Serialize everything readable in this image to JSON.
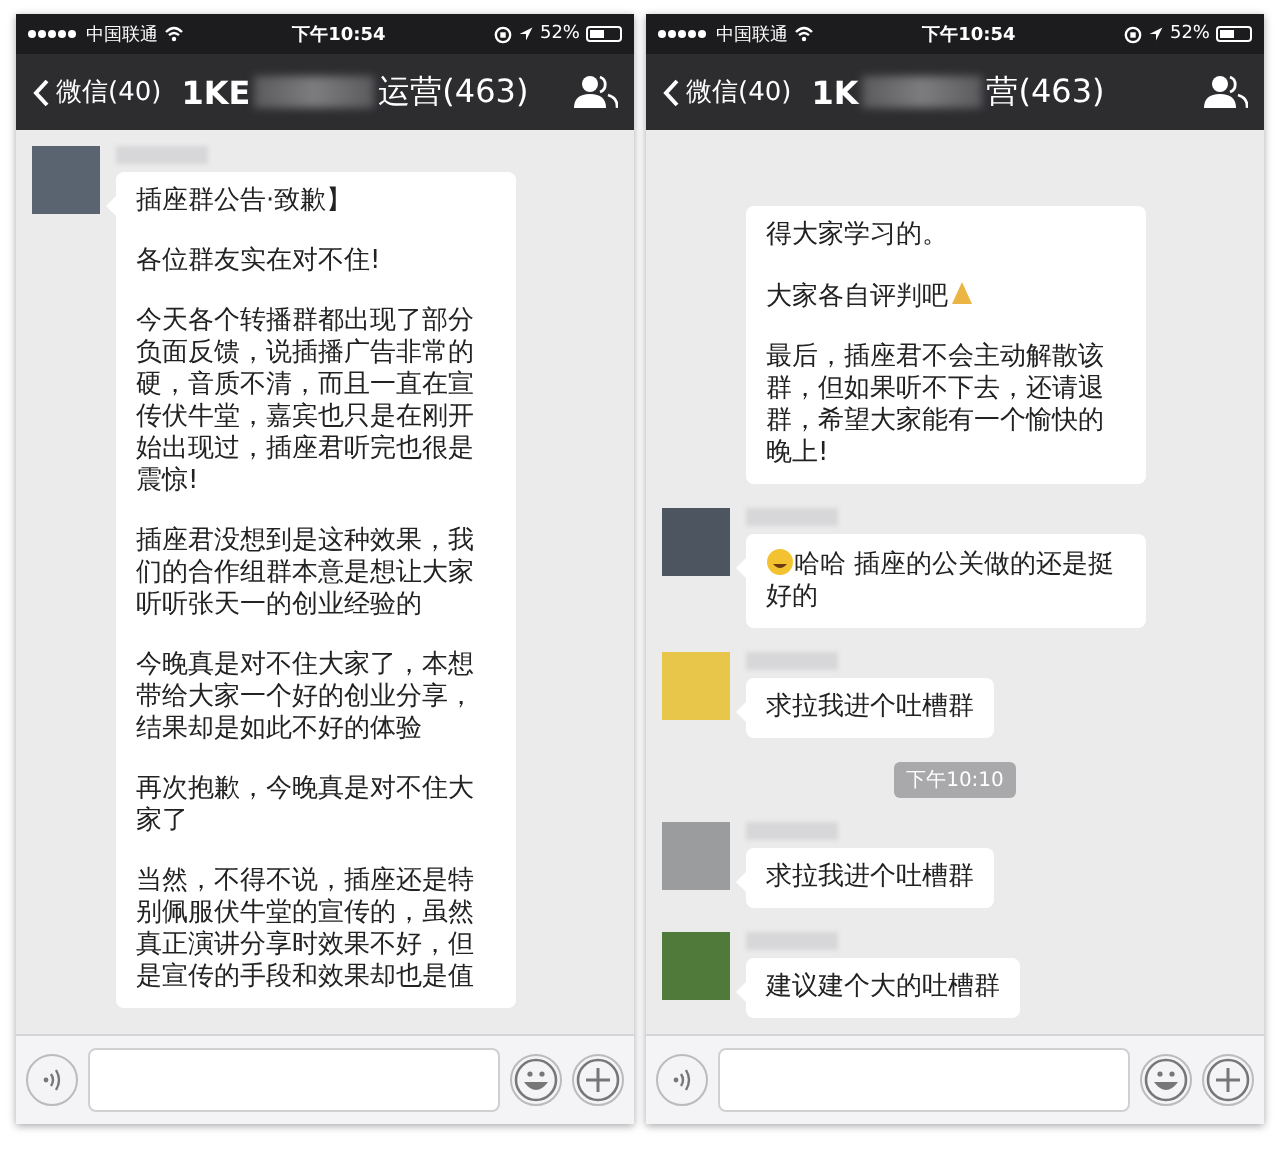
{
  "screens": [
    {
      "status_bar": {
        "carrier": "中国联通",
        "time": "下午10:54",
        "battery": "52%"
      },
      "nav": {
        "back": "微信(40)",
        "title_start": "1KE",
        "title_end": "运营(463)"
      },
      "items": [
        {
          "kind": "message",
          "color": "#5a6470",
          "paragraphs": [
            {
              "text": "插座群公告·致歉】"
            },
            {
              "text": "各位群友实在对不住!"
            },
            {
              "text": "今天各个转播群都出现了部分负面反馈，说插播广告非常的硬，音质不清，而且一直在宣传伏牛堂，嘉宾也只是在刚开始出现过，插座君听完也很是震惊!"
            },
            {
              "text": "插座君没想到是这种效果，我们的合作组群本意是想让大家听听张天一的创业经验的"
            },
            {
              "text": "今晚真是对不住大家了，本想带给大家一个好的创业分享，结果却是如此不好的体验"
            },
            {
              "text": "再次抱歉，今晚真是对不住大家了"
            },
            {
              "text": "当然，不得不说，插座还是特别佩服伏牛堂的宣传的，虽然真正演讲分享时效果不好，但是宣传的手段和效果却也是值"
            }
          ]
        }
      ]
    },
    {
      "status_bar": {
        "carrier": "中国联通",
        "time": "下午10:54",
        "battery": "52%"
      },
      "nav": {
        "back": "微信(40)",
        "title_start": "1K",
        "title_end": "营(463)"
      },
      "items": [
        {
          "kind": "continued",
          "paragraphs": [
            {
              "text": "得大家学习的。"
            },
            {
              "text": "大家各自评判吧",
              "emoji_after": true
            },
            {
              "text": "最后，插座君不会主动解散该群，但如果听不下去，还请退群，希望大家能有一个愉快的晚上!"
            }
          ]
        },
        {
          "kind": "message",
          "color": "#4d5560",
          "paragraphs": [
            {
              "text": "哈哈  插座的公关做的还是挺好的",
              "emoji_before": true
            }
          ]
        },
        {
          "kind": "message",
          "color": "#e8c64a",
          "paragraphs": [
            {
              "text": "求拉我进个吐槽群"
            }
          ]
        },
        {
          "kind": "time",
          "text": "下午10:10"
        },
        {
          "kind": "message",
          "color": "#9a9c9e",
          "paragraphs": [
            {
              "text": "求拉我进个吐槽群"
            }
          ]
        },
        {
          "kind": "message",
          "color": "#4f7a3a",
          "paragraphs": [
            {
              "text": "建议建个大的吐槽群"
            }
          ]
        }
      ]
    }
  ]
}
